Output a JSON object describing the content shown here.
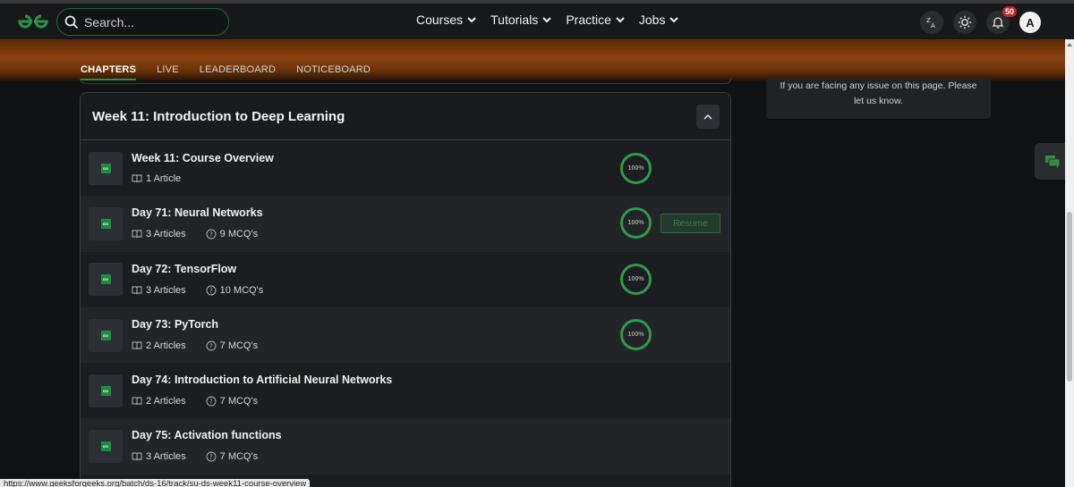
{
  "header": {
    "search_placeholder": "Search...",
    "nav": [
      {
        "label": "Courses"
      },
      {
        "label": "Tutorials"
      },
      {
        "label": "Practice"
      },
      {
        "label": "Jobs"
      }
    ],
    "notification_count": "50",
    "avatar_initial": "A",
    "icons": [
      "translate-icon",
      "theme-icon",
      "bell-icon"
    ]
  },
  "tabs": [
    {
      "label": "CHAPTERS",
      "active": true
    },
    {
      "label": "LIVE"
    },
    {
      "label": "LEADERBOARD"
    },
    {
      "label": "NOTICEBOARD"
    }
  ],
  "section": {
    "title": "Week 11: Introduction to Deep Learning",
    "rows": [
      {
        "title": "Week 11: Course Overview",
        "articles": "1 Article",
        "mcqs": "",
        "progress": "100%"
      },
      {
        "title": "Day 71: Neural Networks",
        "articles": "3 Articles",
        "mcqs": "9 MCQ's",
        "progress": "100%",
        "action": "Resume"
      },
      {
        "title": "Day 72: TensorFlow",
        "articles": "3 Articles",
        "mcqs": "10 MCQ's",
        "progress": "100%"
      },
      {
        "title": "Day 73: PyTorch",
        "articles": "2 Articles",
        "mcqs": "7 MCQ's",
        "progress": "100%"
      },
      {
        "title": "Day 74: Introduction to Artificial Neural Networks",
        "articles": "2 Articles",
        "mcqs": "7 MCQ's",
        "progress": ""
      },
      {
        "title": "Day 75: Activation functions",
        "articles": "3 Articles",
        "mcqs": "7 MCQ's",
        "progress": ""
      }
    ]
  },
  "sidebar": {
    "issue_text_line1": "If you are facing any issue on this page. Please",
    "issue_text_line2": "let us know."
  },
  "status_url": "https://www.geeksforgeeks.org/batch/ds-16/track/su-ds-week11-course-overview",
  "colors": {
    "accent": "#2f8d46",
    "bg": "#0f1113"
  }
}
